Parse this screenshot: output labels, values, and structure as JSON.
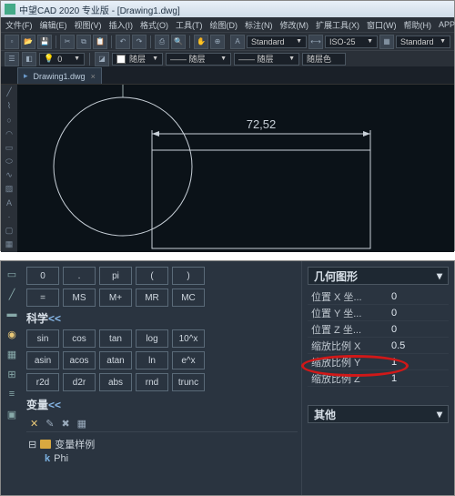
{
  "app": {
    "title": "中望CAD 2020 专业版 - [Drawing1.dwg]"
  },
  "menu": [
    "文件(F)",
    "编辑(E)",
    "视图(V)",
    "插入(I)",
    "格式(O)",
    "工具(T)",
    "绘图(D)",
    "标注(N)",
    "修改(M)",
    "扩展工具(X)",
    "窗口(W)",
    "帮助(H)",
    "APP+"
  ],
  "toolbar2": {
    "style1": "Standard",
    "style2": "ISO-25",
    "style3": "Standard",
    "layerText1": "随层",
    "layerText2": "—— 随层",
    "layerText3": "—— 随层",
    "layerColorBtn": "随层色"
  },
  "docTab": {
    "name": "Drawing1.dwg",
    "close": "×"
  },
  "drawing": {
    "dim_value": "72,52"
  },
  "calc": {
    "row1": [
      "0",
      ".",
      "pi",
      "(",
      ")"
    ],
    "row2": [
      "=",
      "MS",
      "M+",
      "MR",
      "MC"
    ],
    "sec_sci": "科学",
    "sec_link": "<<",
    "row3": [
      "sin",
      "cos",
      "tan",
      "log",
      "10^x"
    ],
    "row4": [
      "asin",
      "acos",
      "atan",
      "ln",
      "e^x"
    ],
    "row5": [
      "r2d",
      "d2r",
      "abs",
      "rnd",
      "trunc"
    ],
    "sec_var": "变量",
    "var_root": "变量样例",
    "var_child": "Phi",
    "var_k": "k"
  },
  "props": {
    "header1": "几何图形",
    "rows1": [
      {
        "label": "位置 X 坐...",
        "val": "0"
      },
      {
        "label": "位置 Y 坐...",
        "val": "0"
      },
      {
        "label": "位置 Z 坐...",
        "val": "0"
      },
      {
        "label": "缩放比例 X",
        "val": "0.5"
      },
      {
        "label": "缩放比例 Y",
        "val": "1"
      },
      {
        "label": "缩放比例 Z",
        "val": "1"
      }
    ],
    "header2": "其他"
  }
}
